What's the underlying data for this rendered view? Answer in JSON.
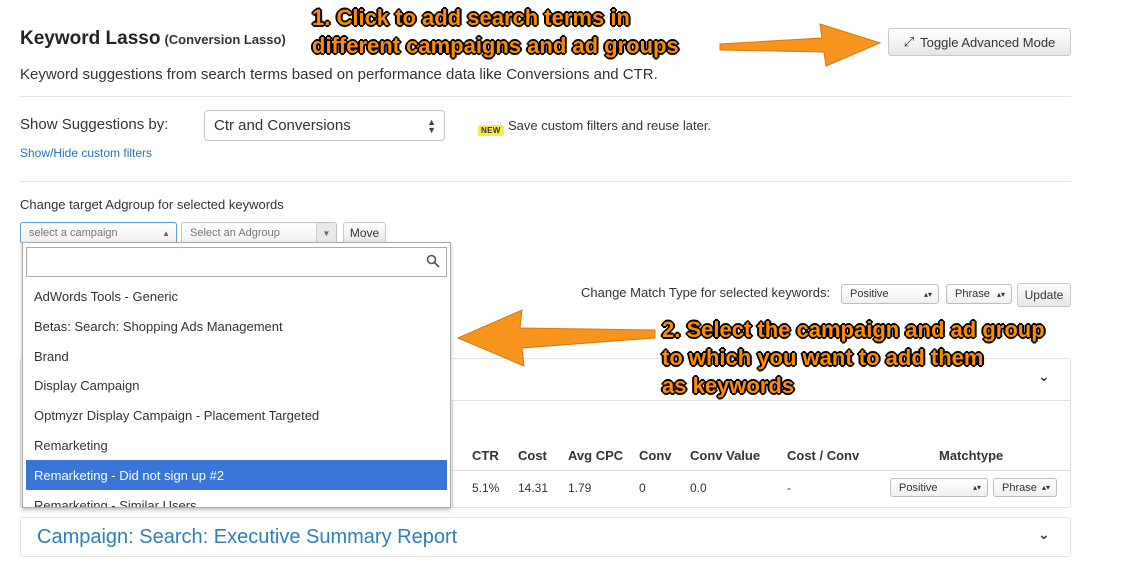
{
  "header": {
    "title": "Keyword Lasso",
    "subtitle": "(Conversion Lasso)",
    "description": "Keyword suggestions from search terms based on performance data like Conversions and CTR.",
    "advanced_mode_button": "Toggle Advanced Mode"
  },
  "suggestions": {
    "label": "Show Suggestions by:",
    "selected": "Ctr and Conversions",
    "new_badge": "NEW",
    "save_text": "Save custom filters and reuse later.",
    "custom_filters_link": "Show/Hide custom filters"
  },
  "target": {
    "label": "Change target Adgroup for selected keywords",
    "campaign_placeholder": "select a campaign",
    "adgroup_placeholder": "Select an Adgroup",
    "move_button": "Move"
  },
  "dropdown": {
    "search_value": "",
    "items": [
      "AdWords Tools - Generic",
      "Betas: Search: Shopping Ads Management",
      "Brand",
      "Display Campaign",
      "Optmyzr Display Campaign - Placement Targeted",
      "Remarketing",
      "Remarketing - Did not sign up #2",
      "Remarketing - Similar Users"
    ],
    "selected_index": 6
  },
  "match_type": {
    "label": "Change Match Type for selected keywords:",
    "type_value": "Positive",
    "match_value": "Phrase",
    "update_button": "Update"
  },
  "table": {
    "headers": [
      "CTR",
      "Cost",
      "Avg CPC",
      "Conv",
      "Conv Value",
      "Cost / Conv",
      "Matchtype"
    ],
    "row": {
      "ctr": "5.1%",
      "cost": "14.31",
      "avg_cpc": "1.79",
      "conv": "0",
      "conv_value": "0.0",
      "cost_per_conv": "-",
      "type_value": "Positive",
      "match_value": "Phrase"
    }
  },
  "campaign_panel": {
    "title": "Campaign: Search: Executive Summary Report"
  },
  "annotations": {
    "step1_line1": "1. Click to add search terms in",
    "step1_line2": "different campaigns and ad groups",
    "step2_line1": "2. Select the campaign and ad group",
    "step2_line2": "to which you want to add them",
    "step2_line3": "as keywords"
  },
  "colors": {
    "annotation": "#ff8c00",
    "link": "#2a72b5",
    "selected_item": "#3875d7",
    "badge": "#f9e94d"
  }
}
